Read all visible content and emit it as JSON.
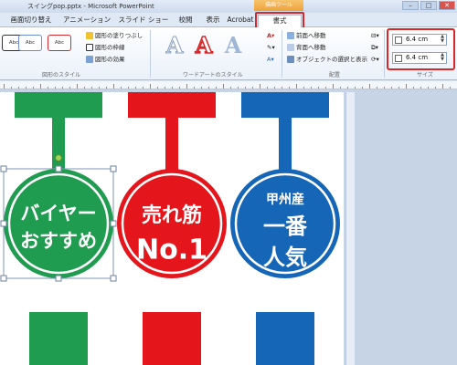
{
  "window": {
    "title": "スイングpop.pptx - Microsoft PowerPoint",
    "contextual_tab_header": "描画ツール"
  },
  "tabs": [
    {
      "label": "画面切り替え"
    },
    {
      "label": "アニメーション"
    },
    {
      "label": "スライド ショー"
    },
    {
      "label": "校閲"
    },
    {
      "label": "表示"
    },
    {
      "label": "Acrobat"
    },
    {
      "label": "書式"
    }
  ],
  "ribbon": {
    "shape_styles": [
      "Abc",
      "Abc",
      "Abc"
    ],
    "shape_cmds": [
      "図形の塗りつぶし",
      "図形の枠線",
      "図形の効果"
    ],
    "group_shape_styles": "図形のスタイル",
    "group_wordart": "ワードアートのスタイル",
    "arrange_cmds": [
      "前面へ移動",
      "背面へ移動",
      "オブジェクトの選択と表示"
    ],
    "group_arrange": "配置",
    "size": {
      "height": "6.4 cm",
      "width": "6.4 cm"
    },
    "group_size": "サイズ"
  },
  "pops": [
    {
      "color": "#1f9c4f",
      "lines": [
        "バイヤー",
        "おすすめ"
      ]
    },
    {
      "color": "#e4161c",
      "lines": [
        "売れ筋",
        "No.1"
      ]
    },
    {
      "color": "#1666b8",
      "lines": [
        "甲州産",
        "一番",
        "人気"
      ]
    }
  ]
}
